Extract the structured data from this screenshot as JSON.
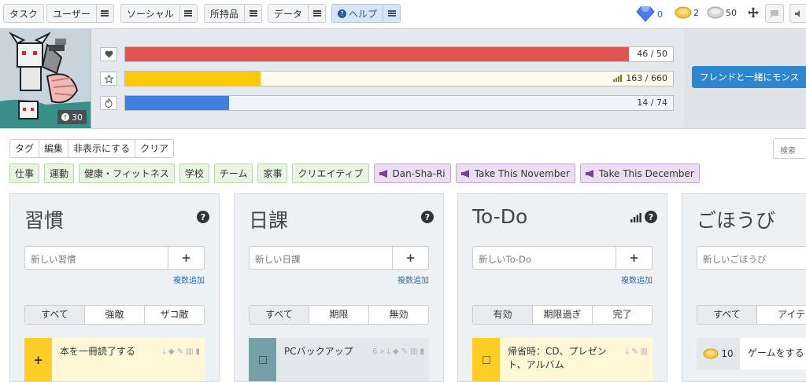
{
  "nav": {
    "items": [
      {
        "label": "タスク"
      },
      {
        "label": "ユーザー"
      },
      {
        "label": "ソーシャル"
      },
      {
        "label": "所持品"
      },
      {
        "label": "データ"
      },
      {
        "label": "ヘルプ"
      }
    ],
    "gems": "0",
    "gold": "2",
    "silver": "50"
  },
  "header": {
    "level": "30",
    "health": {
      "value": 46,
      "max": 50,
      "text": "46 / 50",
      "color": "#e05552"
    },
    "experience": {
      "value": 163,
      "max": 660,
      "text": "163 / 660",
      "color": "#ffc907"
    },
    "mana": {
      "value": 14,
      "max": 74,
      "text": "14 / 74",
      "color": "#3e7fe0"
    },
    "party_button": "フレンドと一緒にモンス"
  },
  "tag_tools": [
    "タグ",
    "編集",
    "非表示にする",
    "クリア"
  ],
  "search_placeholder": "検索",
  "tags": [
    "仕事",
    "運動",
    "健康・フィットネス",
    "学校",
    "チーム",
    "家事",
    "クリエイティブ"
  ],
  "challenge_tags": [
    "Dan-Sha-Ri",
    "Take This November",
    "Take This December"
  ],
  "columns": {
    "habits": {
      "title": "習慣",
      "placeholder": "新しい習慣",
      "bulk": "複数追加",
      "filters": [
        "すべて",
        "強敵",
        "ザコ敵"
      ],
      "task": "本を一冊読了する"
    },
    "dailies": {
      "title": "日課",
      "placeholder": "新しい日課",
      "bulk": "複数追加",
      "filters": [
        "すべて",
        "期限",
        "無効"
      ],
      "task": "PCバックアップ",
      "streak": "6"
    },
    "todos": {
      "title": "To-Do",
      "placeholder": "新しいTo-Do",
      "bulk": "複数追加",
      "filters": [
        "有効",
        "期限過ぎ",
        "完了"
      ],
      "task": "帰省時：CD、プレゼント、アルバム"
    },
    "rewards": {
      "title": "ごほうび",
      "placeholder": "新しいごほうび",
      "filters": [
        "すべて",
        "アイテ"
      ],
      "reward_cost": "10",
      "reward": "ゲームをする"
    }
  }
}
